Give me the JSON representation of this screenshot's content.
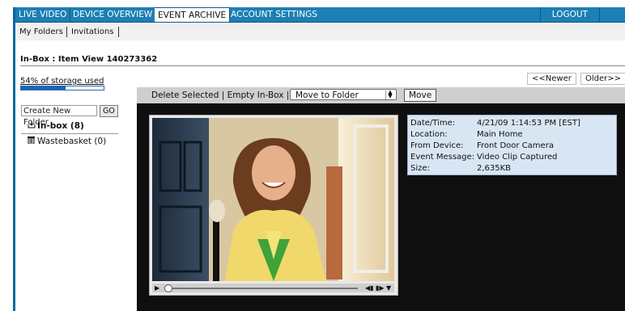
{
  "nav": {
    "tabs": [
      {
        "label": "LIVE VIDEO"
      },
      {
        "label": "DEVICE OVERVIEW"
      },
      {
        "label": "EVENT ARCHIVE"
      },
      {
        "label": "ACCOUNT SETTINGS"
      }
    ],
    "active_tab": "EVENT ARCHIVE",
    "logout": "LOGOUT"
  },
  "subnav": {
    "items": [
      {
        "label": "My Folders"
      },
      {
        "label": "Invitations"
      }
    ]
  },
  "page_title": "In-Box : Item View 140273362",
  "storage": {
    "label": "54% of storage used",
    "percent": 54
  },
  "pager": {
    "newer": "<<Newer",
    "older": "Older>>"
  },
  "toolbar": {
    "delete_selected": "Delete Selected",
    "empty_inbox": "Empty In-Box",
    "move_select_value": "Move to Folder",
    "move_button": "Move"
  },
  "sidebar": {
    "create_placeholder": "Create New Folder",
    "go": "GO",
    "folders": [
      {
        "label": "In-box (8)",
        "icon": "inbox-icon"
      },
      {
        "label": "Wastebasket (0)",
        "icon": "trash-icon"
      }
    ]
  },
  "details": [
    {
      "key": "Date/Time:",
      "value": "4/21/09 1:14:53 PM [EST]"
    },
    {
      "key": "Location:",
      "value": "Main Home"
    },
    {
      "key": "From Device:",
      "value": "Front Door Camera"
    },
    {
      "key": "Event Message:",
      "value": "Video Clip Captured"
    },
    {
      "key": "Size:",
      "value": "2,635KB"
    }
  ],
  "colors": {
    "nav_blue": "#1d7fb4",
    "info_panel": "#d8e6f4",
    "content_bg": "#0f0f0f"
  }
}
